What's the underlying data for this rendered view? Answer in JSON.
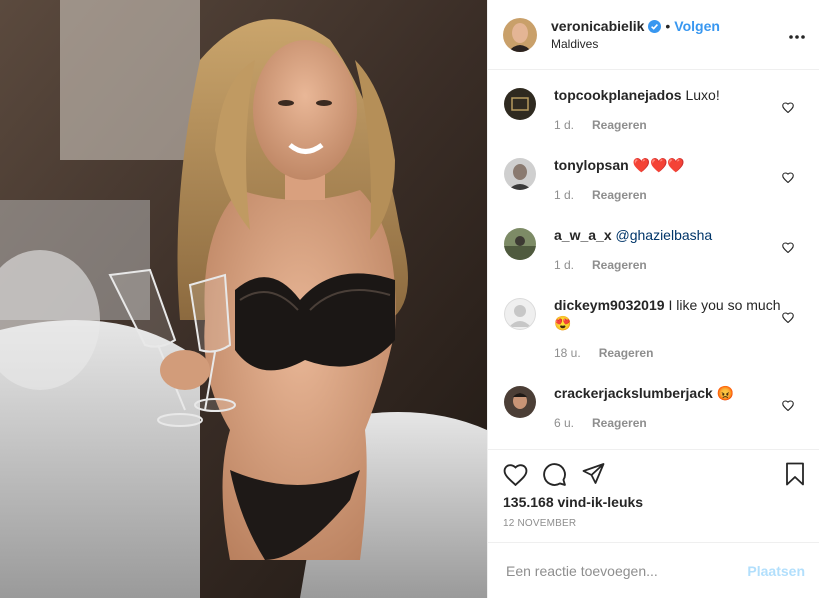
{
  "post": {
    "username": "veronicabielik",
    "follow_label": "Volgen",
    "location": "Maldives",
    "likes": "135.168 vind-ik-leuks",
    "date": "12 NOVEMBER",
    "comment_placeholder": "Een reactie toevoegen...",
    "post_button": "Plaatsen"
  },
  "comments": [
    {
      "user": "topcookplanejados",
      "text": "Luxo!",
      "time": "1 d.",
      "reply": "Reageren",
      "avatar_color": "#2f2a20"
    },
    {
      "user": "tonylopsan",
      "text": "❤️❤️❤️",
      "time": "1 d.",
      "reply": "Reageren",
      "avatar_color": "#c9c9c9"
    },
    {
      "user": "a_w_a_x",
      "text": "@ghazielbasha",
      "time": "1 d.",
      "reply": "Reageren",
      "avatar_color": "#6d7d5a"
    },
    {
      "user": "dickeym9032019",
      "text": "I like you so much😍",
      "time": "18 u.",
      "reply": "Reageren",
      "avatar_color": "#dbdbdb"
    },
    {
      "user": "crackerjackslumberjack",
      "text": "😡",
      "time": "6 u.",
      "reply": "Reageren",
      "avatar_color": "#5a4a40"
    }
  ],
  "icons": {
    "like": "heart-icon",
    "comment": "comment-icon",
    "share": "share-icon",
    "save": "bookmark-icon",
    "more": "more-icon",
    "verified": "verified-badge-icon"
  },
  "colors": {
    "accent": "#3897f0",
    "post_button_disabled": "#b2dffc",
    "meta_gray": "#8e8e8e",
    "mention": "#003569"
  }
}
